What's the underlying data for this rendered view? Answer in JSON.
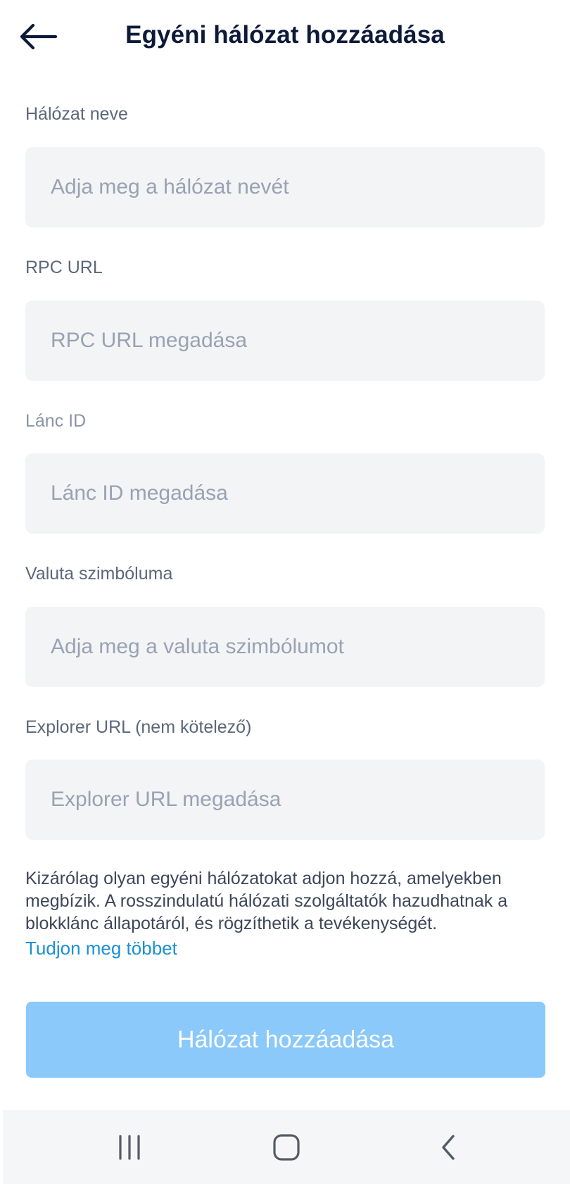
{
  "header": {
    "title": "Egyéni hálózat hozzáadása",
    "back_icon": "arrow-left-icon"
  },
  "form": {
    "fields": [
      {
        "label": "Hálózat neve",
        "placeholder": "Adja meg a hálózat nevét",
        "value": ""
      },
      {
        "label": "RPC URL",
        "placeholder": "RPC URL megadása",
        "value": ""
      },
      {
        "label": "Lánc ID",
        "placeholder": "Lánc ID megadása",
        "value": ""
      },
      {
        "label": "Valuta szimbóluma",
        "placeholder": "Adja meg a valuta szimbólumot",
        "value": ""
      },
      {
        "label": "Explorer URL (nem kötelező)",
        "placeholder": "Explorer URL megadása",
        "value": ""
      }
    ]
  },
  "disclaimer": {
    "text": "Kizárólag olyan egyéni hálózatokat adjon hozzá, amelyekben megbízik. A rosszindulatú hálózati szolgáltatók hazudhatnak a blokklánc állapotáról, és rögzíthetik a tevékenységét.",
    "link": "Tudjon meg többet"
  },
  "submit": {
    "label": "Hálózat hozzáadása",
    "color": "#8ac9f9"
  },
  "system_nav": {
    "recents_icon": "recents-icon",
    "home_icon": "home-icon",
    "back_icon": "chevron-left-icon"
  },
  "colors": {
    "accent_link": "#1a8fd6",
    "input_bg": "#f3f4f6",
    "title": "#0d1a3a"
  }
}
